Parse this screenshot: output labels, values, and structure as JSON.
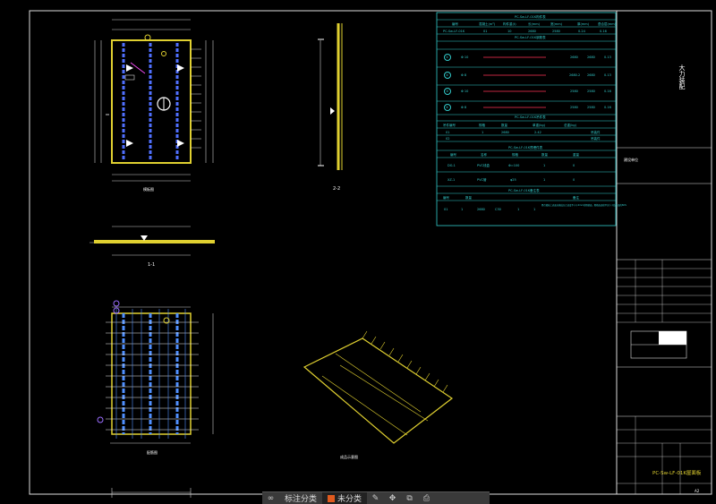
{
  "drawing": {
    "title_block": {
      "company": "大力装配",
      "project_label": "建设单位",
      "drawing_name": "PC-Sw-LF-01K屋面板",
      "sheet_no": "A2"
    },
    "views": {
      "plan_label": "模板图",
      "rebar_label": "配筋图",
      "iso_label": "成品示意图",
      "section_1": "1-1",
      "section_2": "2-2"
    },
    "tables": {
      "t1_title": "PC-Sw-LF-01K构件表",
      "t1_headers": [
        "编号",
        "混凝土(m³)",
        "构件重(t)",
        "长(mm)",
        "宽(mm)",
        "厚(mm)",
        "叠合层(mm)"
      ],
      "t1_row": [
        "PC-Sw-LF-01K",
        "01",
        "10",
        "2680",
        "2580",
        "0.24",
        "0.16"
      ],
      "t2_title": "PC-Sw-LF-01K钢筋表",
      "t2_rows": [
        [
          "①",
          "Φ 10",
          "",
          "2680",
          "1",
          "2680",
          "0.13"
        ],
        [
          "②",
          "Φ 8",
          "",
          "2680.2",
          "1",
          "2680",
          "0.13"
        ],
        [
          "③",
          "Φ 10",
          "",
          "2580",
          "1",
          "2580",
          "0.16"
        ],
        [
          "④",
          "Φ 8",
          "",
          "2580",
          "1",
          "2580",
          "0.16"
        ]
      ],
      "t3_title": "PC-Sw-LF-01K吊件表",
      "t3_headers": [
        "吊件编号",
        "规格",
        "数量",
        "单重(kg)",
        "总重(kg)"
      ],
      "t3_rows": [
        [
          "01",
          "1",
          "2680",
          "2.42",
          "吊装件"
        ],
        [
          "02",
          "",
          "",
          "",
          "吊装件"
        ]
      ],
      "t4_title": "PC-Sw-LF-01K预埋件表",
      "t4_headers": [
        "编号",
        "名称",
        "规格",
        "数量",
        "重量"
      ],
      "t4_rows": [
        [
          "DG-1",
          "PVC线盒",
          "Φ=100",
          "1",
          "0"
        ],
        [
          "XZ-1",
          "PVC管",
          "φ25",
          "1",
          "0"
        ]
      ],
      "t5_title": "PC-Sw-LF-01K备注表",
      "t5_headers": [
        "编号",
        "数量",
        "备注"
      ],
      "t5_row": [
        "01",
        "1",
        "2680",
        "C30",
        "1",
        "1"
      ],
      "t5_note": "叠合楼板上表面应做成凹凸深度不小于4mm的粗糙面，粗糙面面积不宜小于结合面的80%"
    }
  },
  "statusbar": {
    "tab1": "标注分类",
    "tab2": "未分类",
    "icons": [
      "scale-icon",
      "measure-icon",
      "move-icon",
      "copy-icon",
      "print-icon"
    ]
  }
}
